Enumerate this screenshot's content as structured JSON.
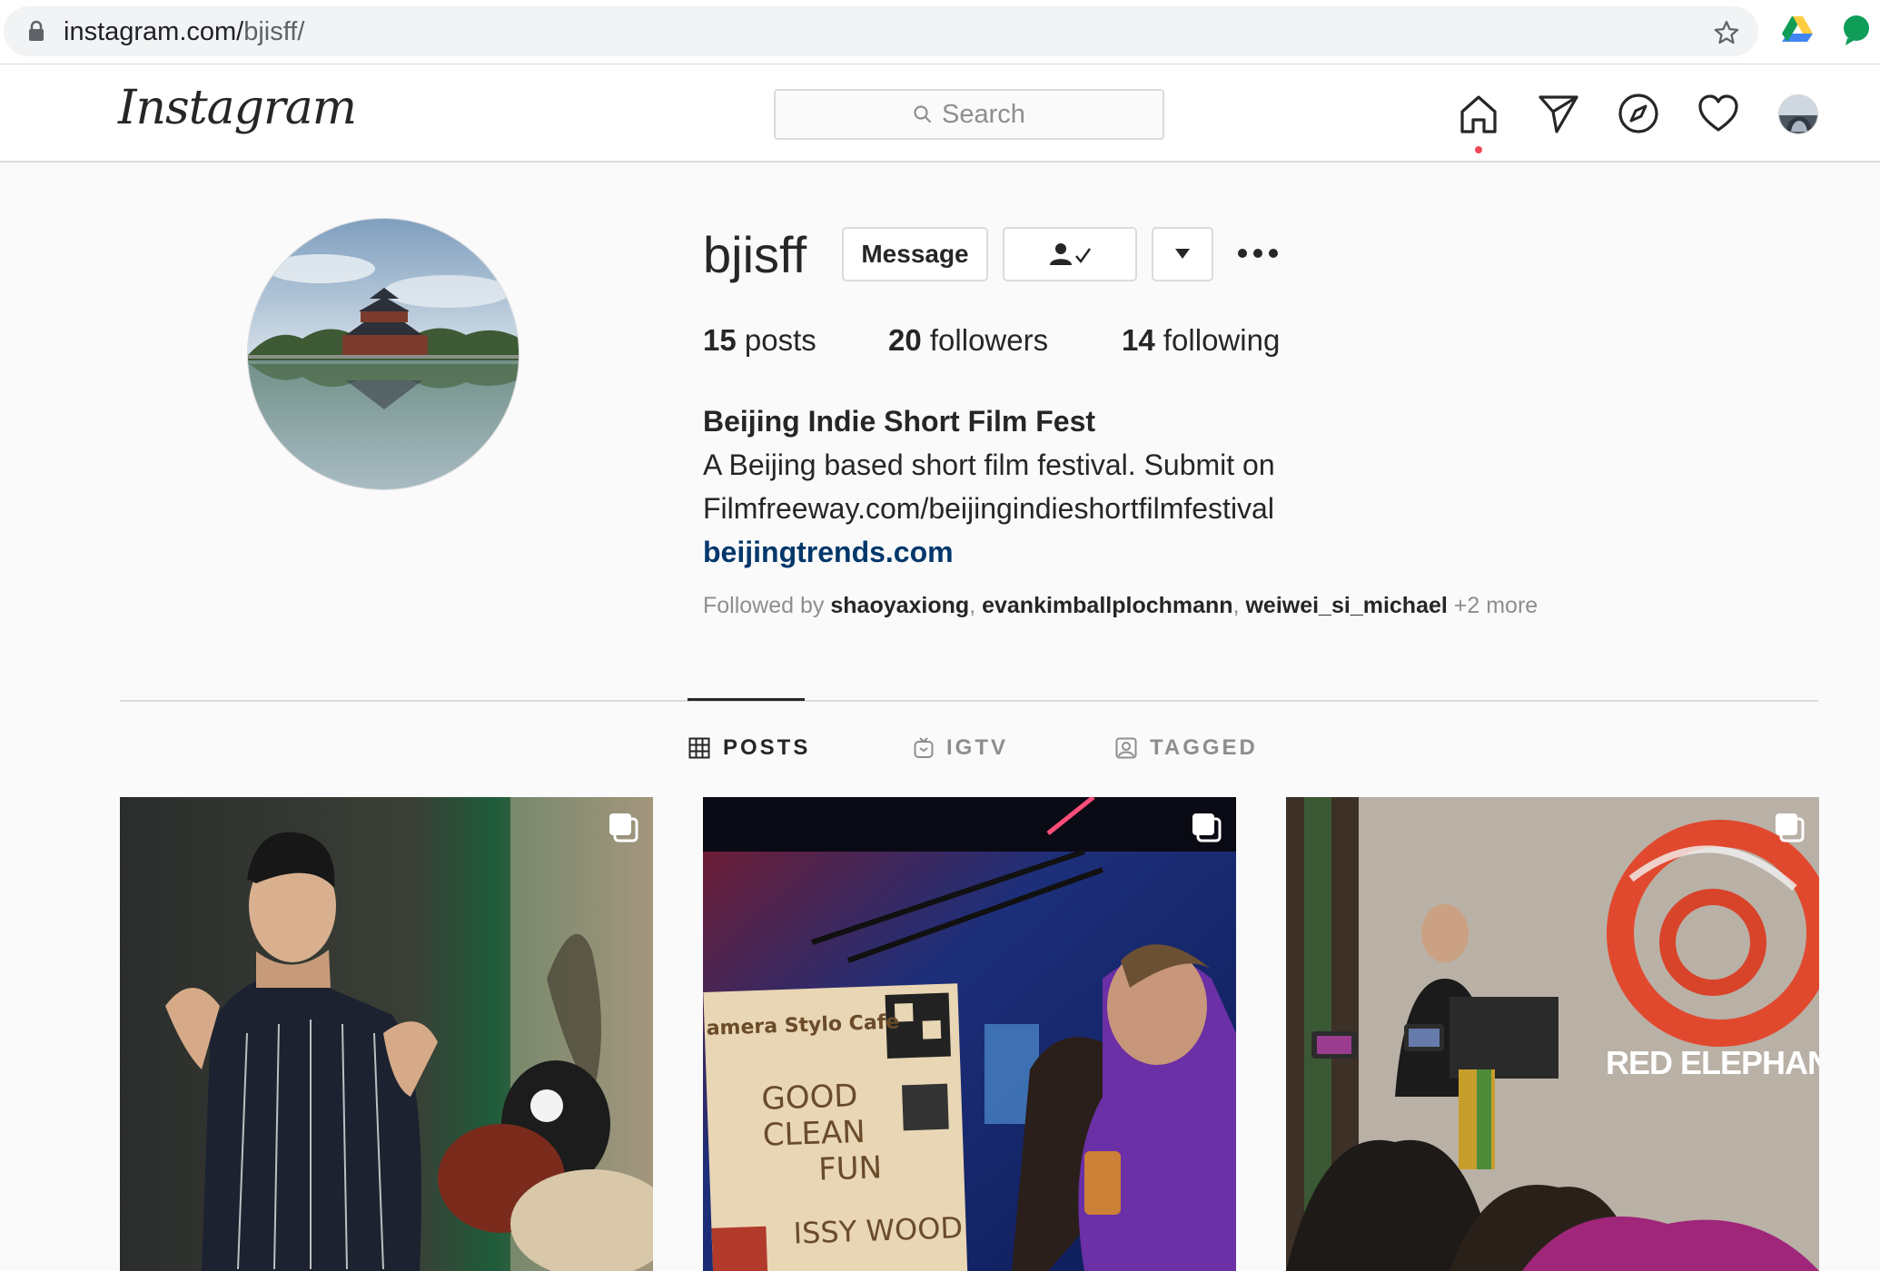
{
  "browser": {
    "url_host": "instagram.com/",
    "url_path": "bjisff/"
  },
  "nav": {
    "logo": "Instagram",
    "search_placeholder": "Search"
  },
  "profile": {
    "username": "bjisff",
    "message_label": "Message",
    "stats": [
      {
        "count": "15",
        "label": "posts"
      },
      {
        "count": "20",
        "label": "followers"
      },
      {
        "count": "14",
        "label": "following"
      }
    ],
    "full_name": "Beijing Indie Short Film Fest",
    "bio_line1": "A Beijing based short film festival. Submit on",
    "bio_line2": "Filmfreeway.com/beijingindieshortfilmfestival",
    "website": "beijingtrends.com",
    "followed_by_prefix": "Followed by",
    "followed_by": [
      "shaoyaxiong",
      "evankimballplochmann",
      "weiwei_si_michael"
    ],
    "followed_more": "+2 more"
  },
  "tabs": [
    {
      "label": "POSTS",
      "icon": "grid-icon",
      "active": true
    },
    {
      "label": "IGTV",
      "icon": "igtv-icon",
      "active": false
    },
    {
      "label": "TAGGED",
      "icon": "tagged-icon",
      "active": false
    }
  ],
  "posts": {
    "post2_sign": {
      "line1": "amera Stylo Cafe",
      "line2": "GOOD",
      "line3": "CLEAN",
      "line4": "FUN",
      "line5": "ISSY WOOD"
    },
    "post3_brand": "RED ELEPHANT"
  },
  "colors": {
    "link": "#00376b",
    "notification_dot": "#ed4956",
    "secondary_text": "#8e8e8e"
  }
}
